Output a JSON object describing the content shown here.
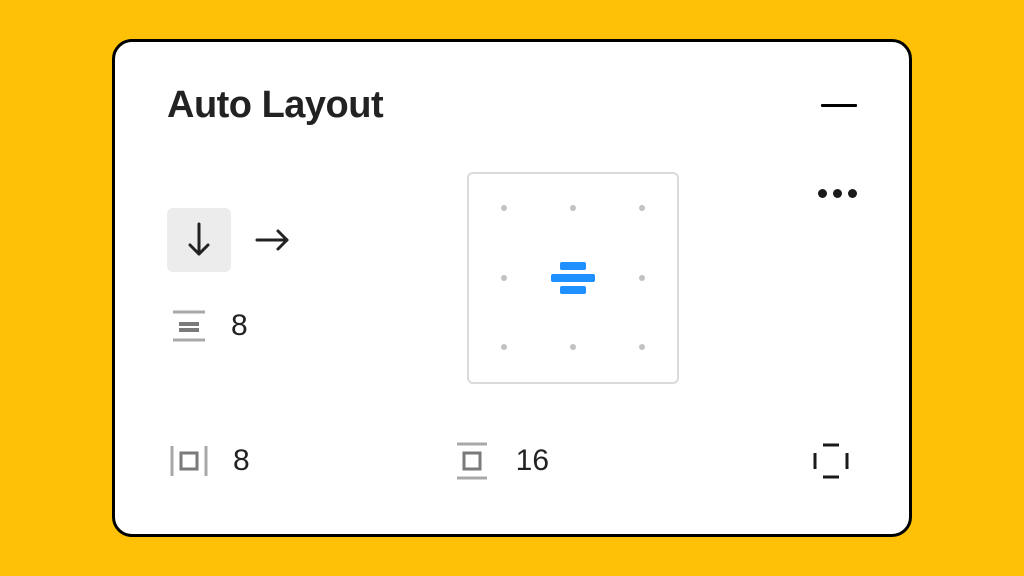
{
  "panel": {
    "title": "Auto Layout",
    "direction": "vertical",
    "item_spacing": "8",
    "padding_horizontal": "8",
    "padding_vertical": "16",
    "alignment": "center-center"
  }
}
